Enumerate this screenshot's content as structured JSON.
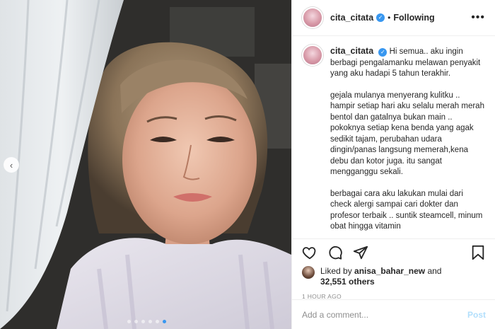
{
  "post": {
    "username": "cita_citata",
    "follow_status": "Following",
    "separator": "•",
    "more_label": "•••"
  },
  "caption": {
    "username": "cita_citata",
    "paragraphs": [
      "Hi semua.. aku ingin berbagi pengalamanku melawan penyakit yang aku hadapi 5 tahun terakhir.",
      "gejala mulanya menyerang kulitku ..\nhampir setiap hari aku selalu merah merah bentol dan gatalnya bukan main ..\npokoknya setiap kena benda yang agak sedikit tajam, perubahan udara dingin/panas langsung memerah,kena debu dan kotor juga. itu sangat mengganggu sekali.",
      "berbagai cara aku lakukan mulai dari check alergi sampai cari dokter dan profesor terbaik .. suntik steamcell, minum obat hingga vitamin"
    ]
  },
  "likes": {
    "prefix": "Liked by",
    "liker": "anisa_bahar_new",
    "conjunction": "and",
    "count_text": "32,551 others"
  },
  "timestamp": "1 HOUR AGO",
  "comment": {
    "placeholder": "Add a comment...",
    "post_label": "Post"
  },
  "carousel": {
    "prev_glyph": "‹",
    "total": 6,
    "active_index": 5
  },
  "icons": {
    "like": "heart-icon",
    "comment": "comment-icon",
    "share": "share-icon",
    "save": "bookmark-icon",
    "verified": "verified-icon"
  },
  "colors": {
    "accent": "#3897f0",
    "post_disabled": "#b2dffc",
    "muted": "#8e8e8e",
    "text": "#262626"
  }
}
